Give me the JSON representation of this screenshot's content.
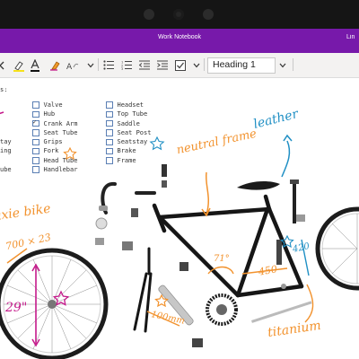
{
  "window": {
    "title": "Work Notebook",
    "user_fragment": "Lin"
  },
  "toolbar": {
    "style_value": "Heading 1",
    "icons": [
      "chevron-left-icon",
      "highlighter-icon",
      "font-color-icon",
      "clear-formatting-icon",
      "chevron-down-icon",
      "bullet-list-icon",
      "numbered-list-icon",
      "decrease-indent-icon",
      "increase-indent-icon",
      "todo-tag-icon",
      "chevron-down-icon",
      "chevron-down-icon"
    ]
  },
  "note": {
    "left_fragments": [
      "s:",
      "tay",
      "ing",
      "ube"
    ],
    "column1": [
      {
        "label": "Valve",
        "checked": false
      },
      {
        "label": "Hub",
        "checked": false
      },
      {
        "label": "Crank Arm",
        "checked": true
      },
      {
        "label": "Seat Tube",
        "checked": false
      },
      {
        "label": "Grips",
        "checked": false
      },
      {
        "label": "Fork",
        "checked": false
      },
      {
        "label": "Head Tube",
        "checked": false
      },
      {
        "label": "Handlebar",
        "checked": false
      }
    ],
    "column2": [
      {
        "label": "Headset",
        "checked": false
      },
      {
        "label": "Top Tube",
        "checked": false
      },
      {
        "label": "Saddle",
        "checked": false
      },
      {
        "label": "Seat Post",
        "checked": false
      },
      {
        "label": "Seatstay",
        "checked": false
      },
      {
        "label": "Brake",
        "checked": false
      },
      {
        "label": "Frame",
        "checked": false
      }
    ]
  },
  "annotations": {
    "neutral_frame": "neutral frame",
    "leather": "leather",
    "fixie_bike": "fixie bike",
    "wheel_size": "700 × 23",
    "wheel_diameter": "29\"",
    "head_tube_angle": "71°",
    "top_tube_length": "450",
    "seat_tube_length": "420",
    "crank_length": "100mm",
    "titanium": "titanium"
  },
  "colors": {
    "accent": "#7719aa",
    "ink_orange": "#f2922d",
    "ink_teal": "#1f8fc4",
    "ink_magenta": "#c4198a"
  }
}
